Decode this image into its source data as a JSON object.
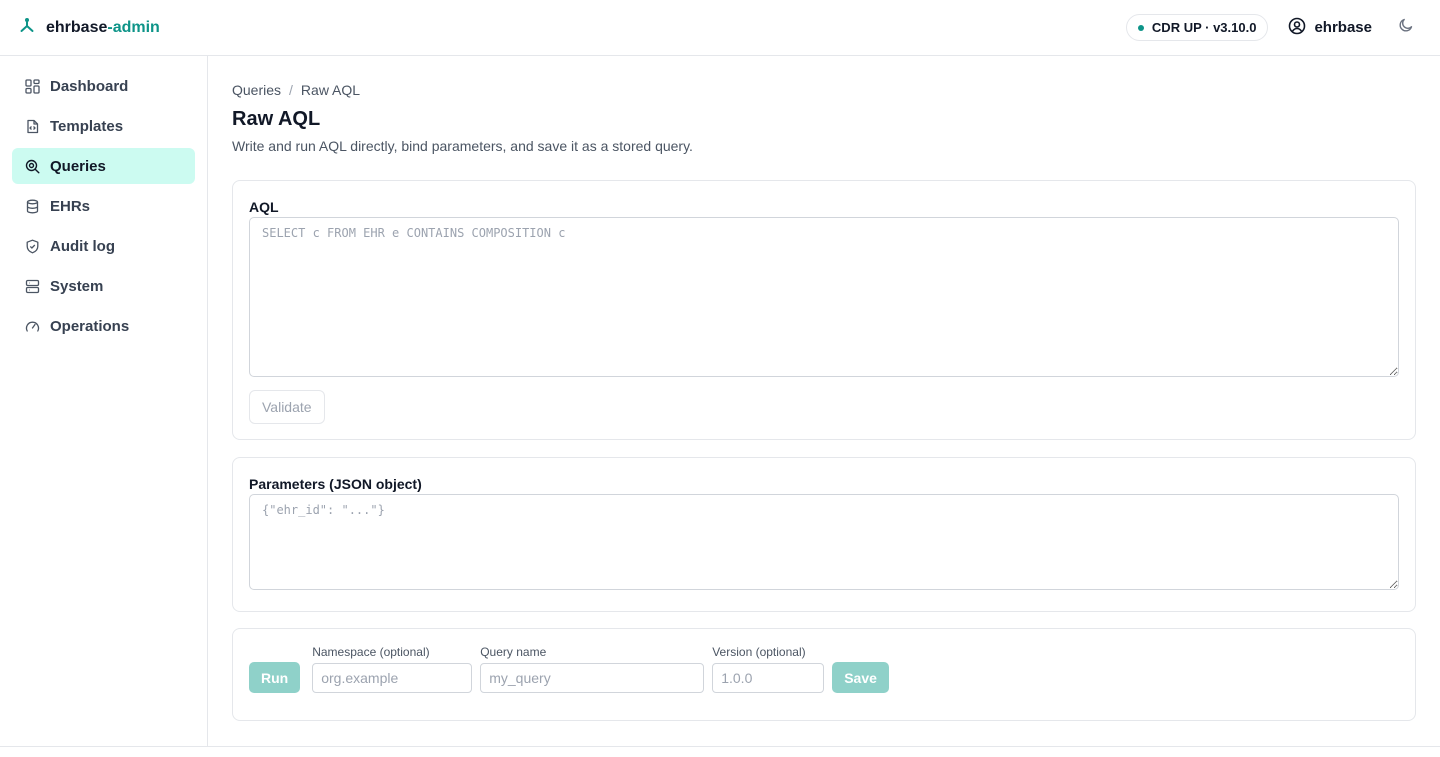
{
  "app": {
    "brand_name": "ehrbase",
    "brand_accent": "-admin",
    "status_text": "CDR UP · v3.10.0",
    "user_name": "ehrbase"
  },
  "sidebar": {
    "items": [
      {
        "label": "Dashboard",
        "icon": "dashboard-icon"
      },
      {
        "label": "Templates",
        "icon": "templates-icon"
      },
      {
        "label": "Queries",
        "icon": "queries-icon",
        "active": true
      },
      {
        "label": "EHRs",
        "icon": "database-icon"
      },
      {
        "label": "Audit log",
        "icon": "shield-icon"
      },
      {
        "label": "System",
        "icon": "server-icon"
      },
      {
        "label": "Operations",
        "icon": "gauge-icon"
      }
    ]
  },
  "breadcrumb": {
    "parent": "Queries",
    "separator": "/",
    "current": "Raw AQL"
  },
  "page": {
    "title": "Raw AQL",
    "description": "Write and run AQL directly, bind parameters, and save it as a stored query."
  },
  "aql": {
    "label": "AQL",
    "value": "",
    "placeholder": "SELECT c FROM EHR e CONTAINS COMPOSITION c",
    "validate_label": "Validate"
  },
  "params": {
    "label": "Parameters (JSON object)",
    "value": "",
    "placeholder": "{\"ehr_id\": \"...\"}"
  },
  "actions": {
    "run_label": "Run",
    "namespace": {
      "label": "Namespace (optional)",
      "placeholder": "org.example",
      "value": ""
    },
    "query_name": {
      "label": "Query name",
      "placeholder": "my_query",
      "value": ""
    },
    "version": {
      "label": "Version (optional)",
      "placeholder": "1.0.0",
      "value": ""
    },
    "save_label": "Save"
  },
  "colors": {
    "accent": "#0d9488",
    "active_nav_bg": "#ccfbf1",
    "disabled_primary": "#8fd1c9"
  }
}
